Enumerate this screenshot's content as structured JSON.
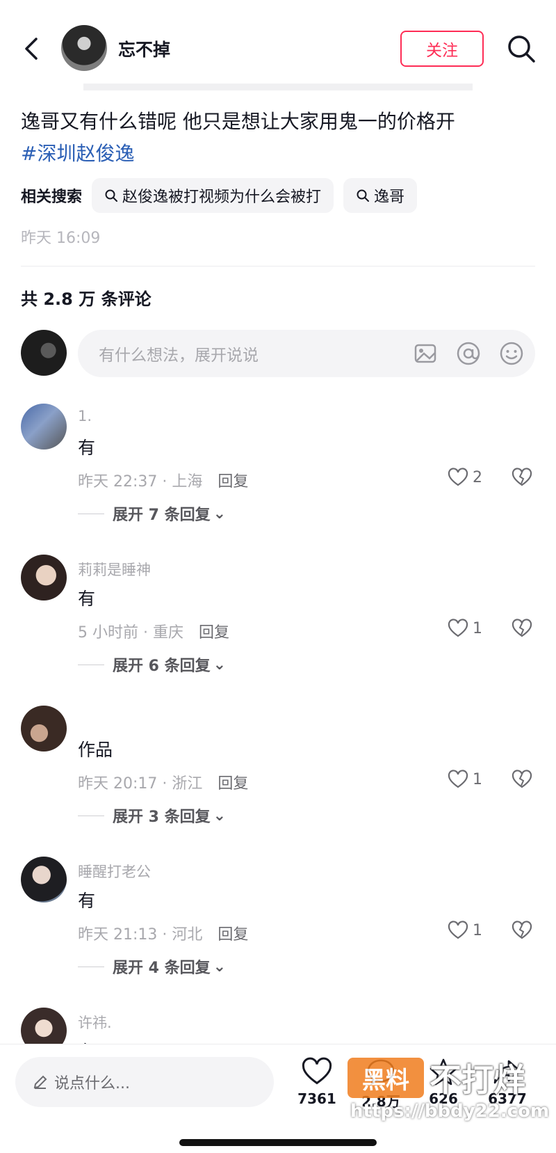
{
  "header": {
    "name": "忘不掉",
    "follow_label": "关注"
  },
  "post": {
    "caption": "逸哥又有什么错呢 他只是想让大家用鬼一的价格开",
    "hashtag": "#深圳赵俊逸",
    "related_label": "相关搜索",
    "related_searches": [
      "赵俊逸被打视频为什么会被打",
      "逸哥"
    ],
    "time": "昨天 16:09"
  },
  "comments_header": "共 2.8 万 条评论",
  "composer": {
    "placeholder": "有什么想法，展开说说"
  },
  "comments": [
    {
      "user": "1.",
      "text": "有",
      "meta": "昨天 22:37 · 上海",
      "reply_label": "回复",
      "likes": "2",
      "expand": "展开 7 条回复"
    },
    {
      "user": "莉莉是睡神",
      "text": "有",
      "meta": "5 小时前 · 重庆",
      "reply_label": "回复",
      "likes": "1",
      "expand": "展开 6 条回复"
    },
    {
      "user": "",
      "text": "作品",
      "meta": "昨天 20:17 · 浙江",
      "reply_label": "回复",
      "likes": "1",
      "expand": "展开 3 条回复"
    },
    {
      "user": "睡醒打老公",
      "text": "有",
      "meta": "昨天 21:13 · 河北",
      "reply_label": "回复",
      "likes": "1",
      "expand": "展开 4 条回复"
    },
    {
      "user": "许祎.",
      "text": "有"
    }
  ],
  "bottom_bar": {
    "say_placeholder": "说点什么...",
    "likes": "7361",
    "comments": "2.8万",
    "favorites": "626",
    "shares": "6377"
  },
  "watermark": {
    "badge": "黑料",
    "text": "不打烊",
    "url": "https://bbdy22.com"
  },
  "colors": {
    "accent": "#fe2c55",
    "hashtag": "#2b5fb5",
    "muted": "#a8a8ad"
  }
}
